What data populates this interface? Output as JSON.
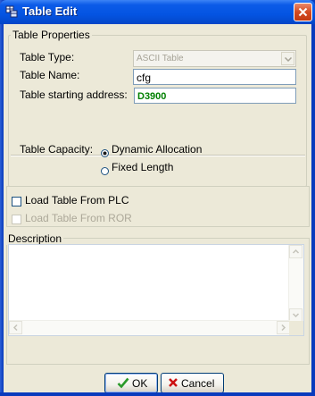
{
  "window": {
    "title": "Table Edit"
  },
  "properties": {
    "legend": "Table Properties",
    "type_label": "Table Type:",
    "type_value": "ASCII Table",
    "name_label": "Table Name:",
    "name_value": "cfg",
    "address_label": "Table starting address:",
    "address_value": "D3900",
    "capacity_label": "Table Capacity:",
    "capacity_options": [
      "Dynamic Allocation",
      "Fixed Length"
    ],
    "capacity_selected": "Dynamic Allocation"
  },
  "load": {
    "plc_label": "Load Table From PLC",
    "plc_checked": false,
    "ror_label": "Load Table From ROR",
    "ror_checked": false,
    "ror_enabled": false
  },
  "description": {
    "legend": "Description",
    "value": ""
  },
  "buttons": {
    "ok_label": "OK",
    "cancel_label": "Cancel"
  },
  "colors": {
    "titlebar": "#0454e2",
    "dialog_bg": "#ece9d8",
    "address_text": "#008000",
    "ok_icon": "#2a9a2a",
    "cancel_icon": "#cc1111"
  },
  "icons": [
    "table-icon",
    "close-icon",
    "chevron-down-icon",
    "checkmark-icon",
    "x-icon",
    "scroll-up-icon",
    "scroll-down-icon",
    "scroll-left-icon",
    "scroll-right-icon"
  ]
}
